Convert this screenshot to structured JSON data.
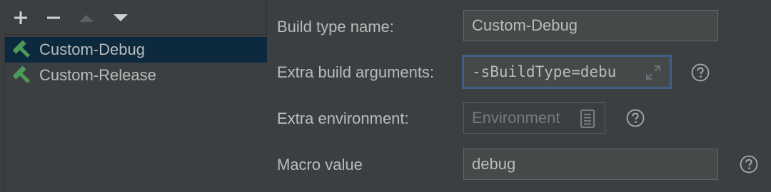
{
  "toolbar": {
    "add_icon": "plus-icon",
    "remove_icon": "minus-icon",
    "move_up_icon": "triangle-up-icon",
    "move_down_icon": "triangle-down-icon"
  },
  "build_types": [
    {
      "label": "Custom-Debug",
      "icon": "hammer-icon",
      "selected": true
    },
    {
      "label": "Custom-Release",
      "icon": "hammer-icon",
      "selected": false
    }
  ],
  "form": {
    "build_type_name": {
      "label": "Build type name:",
      "value": "Custom-Debug"
    },
    "extra_build_arguments": {
      "label": "Extra build arguments:",
      "value": "-sBuildType=debu"
    },
    "extra_environment": {
      "label": "Extra environment:",
      "placeholder": "Environment"
    },
    "macro_value": {
      "label": "Macro value",
      "value": "debug"
    }
  },
  "colors": {
    "background": "#3c3f41",
    "selection": "#0d293e",
    "focus_border": "#3d6185",
    "hammer_green": "#4c9a5a",
    "text": "#bbbbbb"
  }
}
